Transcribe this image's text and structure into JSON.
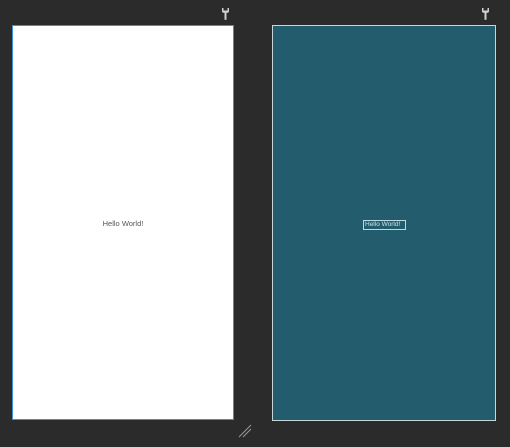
{
  "design_view": {
    "text": "Hello World!"
  },
  "blueprint_view": {
    "text": "Hello World!"
  },
  "icons": {
    "left_toolbar_icon": "wrench-icon",
    "right_toolbar_icon": "wrench-icon",
    "resize": "resize-handle-icon"
  },
  "colors": {
    "background": "#2b2b2b",
    "design_surface": "#ffffff",
    "design_border": "#3d8fd6",
    "blueprint_surface": "#235d6d",
    "blueprint_border": "#c7d4d8",
    "text_design": "#555555",
    "text_blueprint": "#c9e3ea"
  }
}
